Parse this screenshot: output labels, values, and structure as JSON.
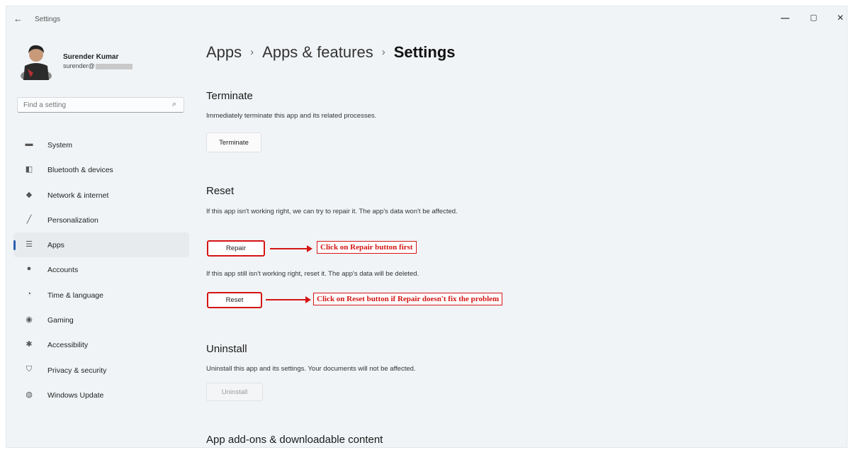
{
  "window": {
    "title": "Settings",
    "back_icon": "←",
    "minimize_icon": "—",
    "maximize_icon": "▢",
    "close_icon": "✕"
  },
  "profile": {
    "name": "Surender Kumar",
    "email_visible": "surender@"
  },
  "search": {
    "placeholder": "Find a setting",
    "icon": "⌕"
  },
  "nav": {
    "items": [
      {
        "label": "System",
        "icon": "▬"
      },
      {
        "label": "Bluetooth & devices",
        "icon": "◧"
      },
      {
        "label": "Network & internet",
        "icon": "◆"
      },
      {
        "label": "Personalization",
        "icon": "╱"
      },
      {
        "label": "Apps",
        "icon": "☰"
      },
      {
        "label": "Accounts",
        "icon": "●"
      },
      {
        "label": "Time & language",
        "icon": "◔"
      },
      {
        "label": "Gaming",
        "icon": "◉"
      },
      {
        "label": "Accessibility",
        "icon": "✱"
      },
      {
        "label": "Privacy & security",
        "icon": "⛉"
      },
      {
        "label": "Windows Update",
        "icon": "◍"
      }
    ],
    "active_index": 4
  },
  "breadcrumb": {
    "items": [
      "Apps",
      "Apps & features",
      "Settings"
    ],
    "separator": "›"
  },
  "terminate": {
    "title": "Terminate",
    "description": "Immediately terminate this app and its related processes.",
    "button": "Terminate"
  },
  "reset": {
    "title": "Reset",
    "repair_description": "If this app isn't working right, we can try to repair it. The app's data won't be affected.",
    "repair_button": "Repair",
    "repair_callout": "Click on Repair button first",
    "reset_description": "If this app still isn't working right, reset it. The app's data will be deleted.",
    "reset_button": "Reset",
    "reset_callout": "Click on Reset button if Repair doesn't fix the problem"
  },
  "uninstall": {
    "title": "Uninstall",
    "description": "Uninstall this app and its settings. Your documents will not be affected.",
    "button": "Uninstall"
  },
  "addons": {
    "title": "App add-ons & downloadable content"
  },
  "colors": {
    "accent": "#2a5fb0",
    "annotation": "#d51515",
    "background": "#f1f4f6"
  }
}
